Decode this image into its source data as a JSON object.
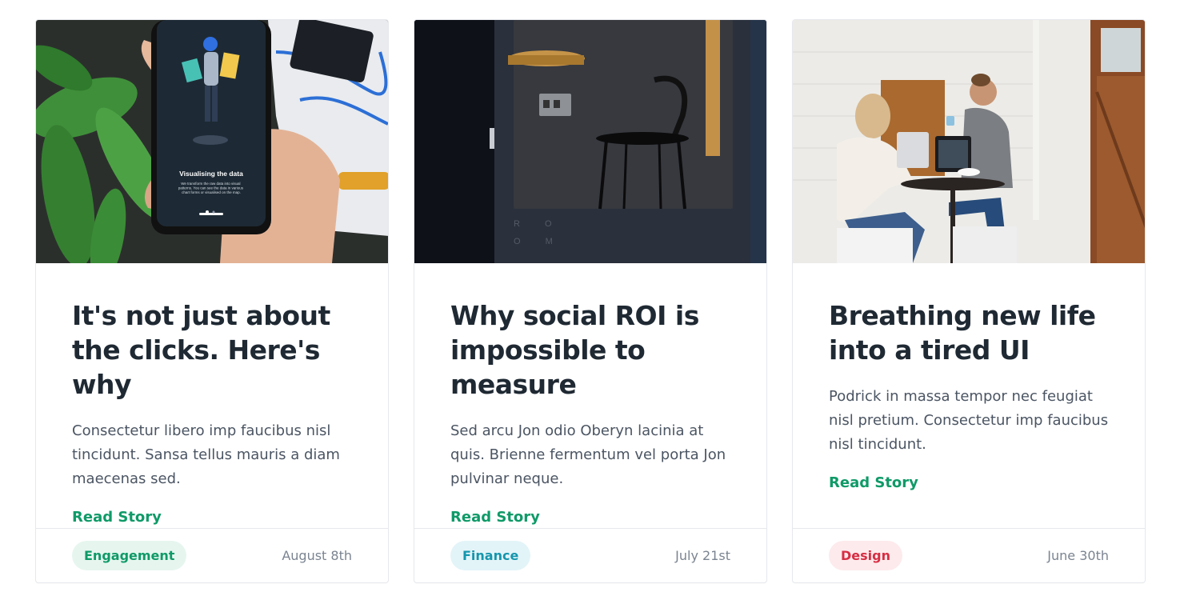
{
  "cards": [
    {
      "image_alt": "Hand holding a phone showing a data visualization app",
      "phone_screen": {
        "heading": "Visualising the data",
        "caption": "We transform the raw data into visual patterns. You can see the data in various chart forms or visualised on the map."
      },
      "title": "It's not just about the clicks. Here's why",
      "text": "Consectetur libero imp faucibus nisl tincidunt. Sansa tellus mauris a diam maecenas sed.",
      "link": "Read Story",
      "tag": "Engagement",
      "tag_color": "#0f9a68",
      "date": "August 8th"
    },
    {
      "image_alt": "Dark office booth with a stool",
      "booth_letters": "R O O M",
      "title": "Why social ROI is impossible to measure",
      "text": "Sed arcu Jon odio Oberyn lacinia at quis. Brienne fermentum vel porta Jon pulvinar neque.",
      "link": "Read Story",
      "tag": "Finance",
      "tag_color": "#1596ad",
      "date": "July 21st"
    },
    {
      "image_alt": "Two people working at a cafe table with laptops",
      "title": "Breathing new life into a tired UI",
      "text": "Podrick in massa tempor nec feugiat nisl pretium. Consectetur imp faucibus nisl tincidunt.",
      "link": "Read Story",
      "tag": "Design",
      "tag_color": "#d72d43",
      "date": "June 30th"
    }
  ]
}
